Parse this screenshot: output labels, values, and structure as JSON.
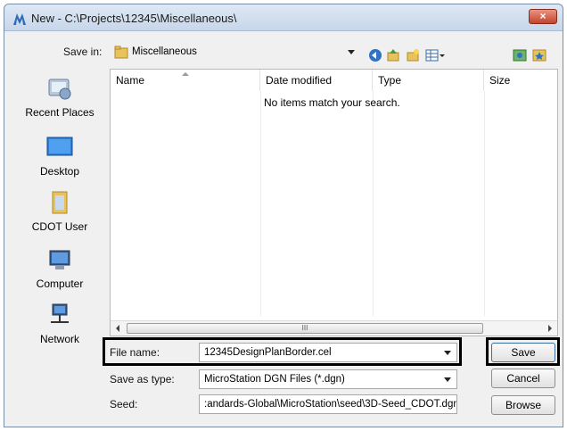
{
  "window": {
    "title": "New - C:\\Projects\\12345\\Miscellaneous\\",
    "close_label": "×"
  },
  "save_in": {
    "label": "Save in:",
    "value": "Miscellaneous"
  },
  "toolbar": {
    "icons": [
      "back-icon",
      "up-folder-icon",
      "new-folder-icon",
      "view-menu-icon",
      "network-icon",
      "favorites-icon"
    ]
  },
  "places": [
    {
      "label": "Recent Places",
      "icon": "recent-places-icon"
    },
    {
      "label": "Desktop",
      "icon": "desktop-icon"
    },
    {
      "label": "CDOT User",
      "icon": "user-folder-icon"
    },
    {
      "label": "Computer",
      "icon": "computer-icon"
    },
    {
      "label": "Network",
      "icon": "network-icon"
    }
  ],
  "filelist": {
    "columns": [
      "Name",
      "Date modified",
      "Type",
      "Size"
    ],
    "empty_message": "No items match your search.",
    "scroll_grip": "III"
  },
  "file_name": {
    "label": "File name:",
    "value": "12345DesignPlanBorder.cel"
  },
  "save_as_type": {
    "label": "Save as type:",
    "value": "MicroStation DGN Files (*.dgn)"
  },
  "seed": {
    "label": "Seed:",
    "value": ":andards-Global\\MicroStation\\seed\\3D-Seed_CDOT.dgn"
  },
  "buttons": {
    "save": "Save",
    "cancel": "Cancel",
    "browse": "Browse"
  },
  "colors": {
    "highlight_border": "#000000",
    "accent": "#3a6ea5"
  }
}
